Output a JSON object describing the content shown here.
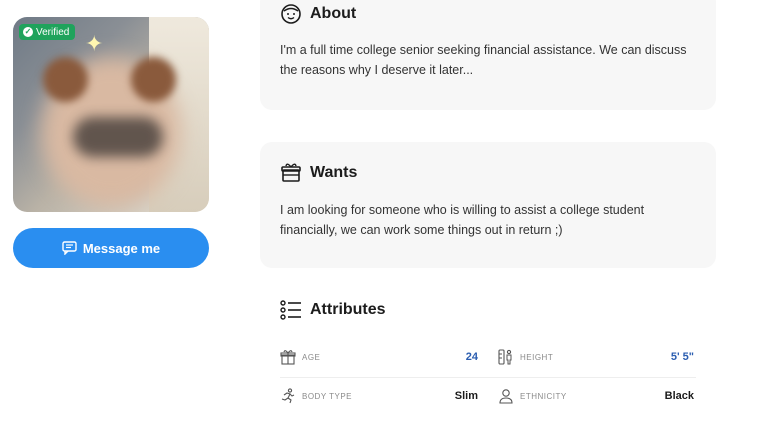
{
  "profile": {
    "verified_label": "Verified",
    "message_button_label": "Message me"
  },
  "about": {
    "title": "About",
    "text": "I'm a full time college senior seeking financial assistance. We can discuss the reasons why I deserve it later..."
  },
  "wants": {
    "title": "Wants",
    "text": "I am looking for someone who is willing to assist a college student financially, we can work some things out in return ;)"
  },
  "attributes": {
    "title": "Attributes",
    "items": [
      {
        "label": "AGE",
        "value": "24",
        "icon": "gift-icon",
        "color": "#2a5db0"
      },
      {
        "label": "HEIGHT",
        "value": "5' 5\"",
        "icon": "height-icon",
        "color": "#2a5db0"
      },
      {
        "label": "BODY TYPE",
        "value": "Slim",
        "icon": "running-person-icon",
        "color": "#1c1c1c"
      },
      {
        "label": "ETHNICITY",
        "value": "Black",
        "icon": "person-icon",
        "color": "#1c1c1c"
      }
    ]
  },
  "colors": {
    "accent": "#2a8ef0",
    "verified": "#1fa35c",
    "card_bg": "#f7f7f7"
  }
}
